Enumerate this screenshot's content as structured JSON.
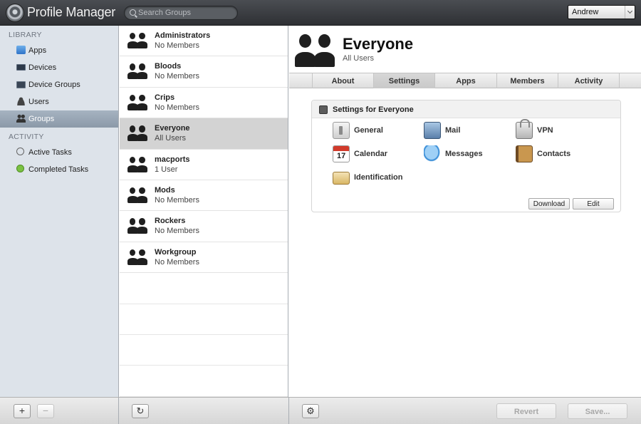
{
  "app": {
    "title": "Profile Manager",
    "search_placeholder": "Search Groups",
    "user": "Andrew"
  },
  "sidebar": {
    "library_header": "LIBRARY",
    "library_items": [
      {
        "label": "Apps",
        "icon": "apps-icon"
      },
      {
        "label": "Devices",
        "icon": "devices-icon"
      },
      {
        "label": "Device Groups",
        "icon": "device-groups-icon"
      },
      {
        "label": "Users",
        "icon": "users-icon"
      },
      {
        "label": "Groups",
        "icon": "groups-icon",
        "selected": true
      }
    ],
    "activity_header": "ACTIVITY",
    "activity_items": [
      {
        "label": "Active Tasks",
        "icon": "active-tasks-icon"
      },
      {
        "label": "Completed Tasks",
        "icon": "completed-tasks-icon"
      }
    ],
    "add_label": "+",
    "remove_label": "−"
  },
  "groups": [
    {
      "name": "Administrators",
      "sub": "No Members"
    },
    {
      "name": "Bloods",
      "sub": "No Members"
    },
    {
      "name": "Crips",
      "sub": "No Members"
    },
    {
      "name": "Everyone",
      "sub": "All Users",
      "selected": true
    },
    {
      "name": "macports",
      "sub": "1 User"
    },
    {
      "name": "Mods",
      "sub": "No Members"
    },
    {
      "name": "Rockers",
      "sub": "No Members"
    },
    {
      "name": "Workgroup",
      "sub": "No Members"
    }
  ],
  "list_footer": {
    "refresh_label": "↻"
  },
  "detail": {
    "title": "Everyone",
    "subtitle": "All Users",
    "tabs": [
      "About",
      "Settings",
      "Apps",
      "Members",
      "Activity"
    ],
    "active_tab": "Settings",
    "settings_panel": {
      "title": "Settings for Everyone",
      "payloads": [
        {
          "label": "General",
          "icon": "general-icon"
        },
        {
          "label": "Mail",
          "icon": "mail-icon"
        },
        {
          "label": "VPN",
          "icon": "vpn-icon"
        },
        {
          "label": "Calendar",
          "icon": "calendar-icon",
          "icon_text": "17"
        },
        {
          "label": "Messages",
          "icon": "messages-icon"
        },
        {
          "label": "Contacts",
          "icon": "contacts-icon"
        },
        {
          "label": "Identification",
          "icon": "identification-icon"
        }
      ],
      "download_label": "Download",
      "edit_label": "Edit"
    },
    "footer": {
      "gear_label": "⚙",
      "revert_label": "Revert",
      "save_label": "Save..."
    }
  }
}
